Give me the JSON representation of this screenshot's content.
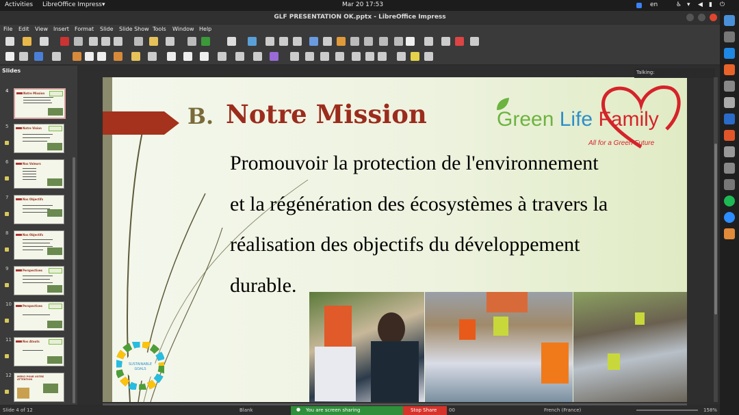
{
  "system": {
    "activities": "Activities",
    "app_menu": "LibreOffice Impress",
    "clock": "Mar 20  17:53",
    "language": "en"
  },
  "window": {
    "title": "GLF PRESENTATION OK.pptx - LibreOffice Impress"
  },
  "menu": [
    "File",
    "Edit",
    "View",
    "Insert",
    "Format",
    "Slide",
    "Slide Show",
    "Tools",
    "Window",
    "Help"
  ],
  "slides_panel": {
    "title": "Slides",
    "thumbs": [
      {
        "num": "4",
        "title": "Notre Mission"
      },
      {
        "num": "5",
        "title": "Notre Vision"
      },
      {
        "num": "6",
        "title": "Nos Valeurs"
      },
      {
        "num": "7",
        "title": "Nos Objectifs"
      },
      {
        "num": "8",
        "title": "Nos Objectifs"
      },
      {
        "num": "9",
        "title": "Perspectives"
      },
      {
        "num": "10",
        "title": "Perspectives"
      },
      {
        "num": "11",
        "title": "Nos Atouts"
      },
      {
        "num": "12",
        "title": "MERCI POUR VOTRE ATTENTION"
      }
    ]
  },
  "slide": {
    "heading_letter": "B.",
    "heading": "Notre Mission",
    "body_lines": [
      "Promouvoir la protection de l'environnement",
      "et la régénération des écosystèmes à travers la",
      "réalisation des objectifs du développement",
      "durable."
    ],
    "logo": {
      "part1": "Green",
      "part2": " Life",
      "part3": " Family",
      "tagline": "All for a Green Future"
    },
    "sdg_label": "SUSTAINABLE GOALS"
  },
  "talking": "Talking:",
  "status": {
    "slide_count": "Slide 4 of 12",
    "layout": "Blank",
    "sharing": "You are screen sharing",
    "stop_share": "Stop Share",
    "language": "French (France)",
    "zoom": "158%",
    "zoom_partial": "00"
  },
  "colors": {
    "accent_red": "#9b2c1d",
    "logo_green": "#6db33f",
    "logo_blue": "#2d8fc8",
    "logo_red": "#d5232a"
  }
}
